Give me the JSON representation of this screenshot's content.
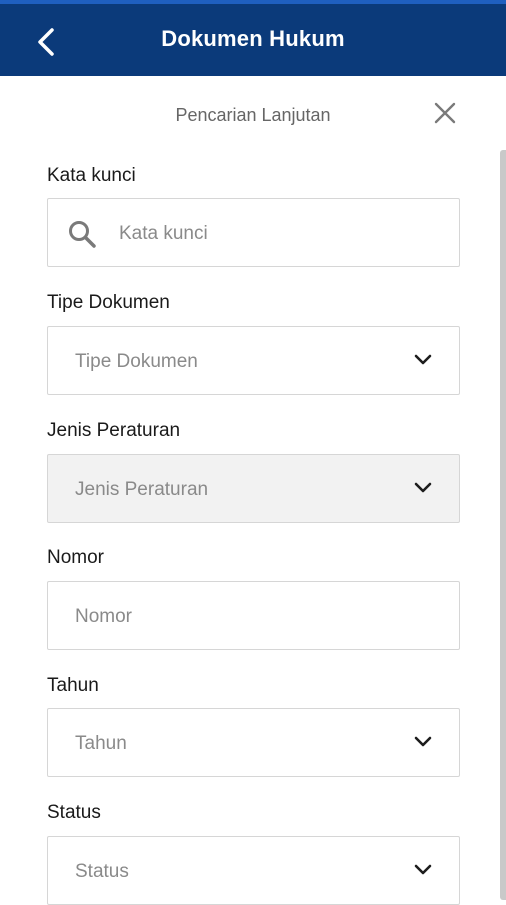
{
  "appbar": {
    "title": "Dokumen Hukum",
    "back_icon": "back-arrow-icon",
    "color": "#0b3a7a"
  },
  "sheet": {
    "title": "Pencarian Lanjutan",
    "close_icon": "close-icon"
  },
  "fields": {
    "keyword": {
      "label": "Kata kunci",
      "placeholder": "Kata kunci",
      "icon": "search-icon"
    },
    "doc_type": {
      "label": "Tipe Dokumen",
      "placeholder": "Tipe Dokumen",
      "icon": "chevron-down-icon"
    },
    "regulation_type": {
      "label": "Jenis Peraturan",
      "placeholder": "Jenis Peraturan",
      "icon": "chevron-down-icon",
      "disabled": true
    },
    "number": {
      "label": "Nomor",
      "placeholder": "Nomor"
    },
    "year": {
      "label": "Tahun",
      "placeholder": "Tahun",
      "icon": "chevron-down-icon"
    },
    "status": {
      "label": "Status",
      "placeholder": "Status",
      "icon": "chevron-down-icon"
    }
  }
}
